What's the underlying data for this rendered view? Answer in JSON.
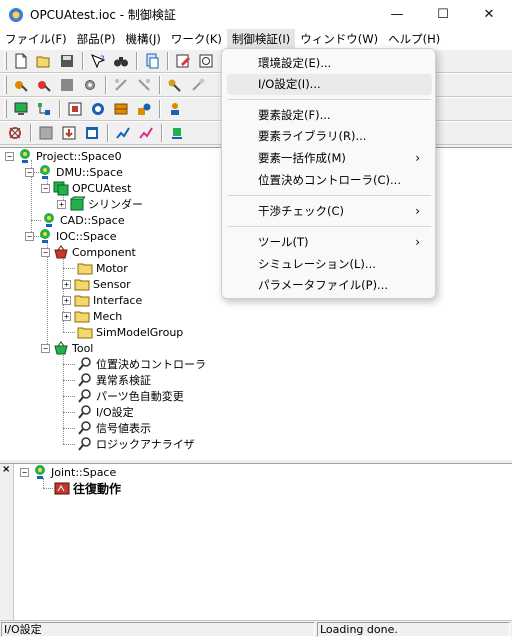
{
  "window": {
    "title": "OPCUAtest.ioc - 制御検証",
    "minimize_glyph": "—",
    "maximize_glyph": "☐",
    "close_glyph": "✕"
  },
  "menubar": {
    "items": [
      {
        "label": "ファイル(F)"
      },
      {
        "label": "部品(P)"
      },
      {
        "label": "機構(J)"
      },
      {
        "label": "ワーク(K)"
      },
      {
        "label": "制御検証(I)"
      },
      {
        "label": "ウィンドウ(W)"
      },
      {
        "label": "ヘルプ(H)"
      }
    ]
  },
  "dropdown": {
    "items": [
      {
        "label": "環境設定(E)..."
      },
      {
        "label": "I/O設定(I)..."
      },
      {
        "label": "要素設定(F)..."
      },
      {
        "label": "要素ライブラリ(R)..."
      },
      {
        "label": "要素一括作成(M)",
        "submenu_glyph": "›"
      },
      {
        "label": "位置決めコントローラ(C)..."
      },
      {
        "label": "干渉チェック(C)",
        "submenu_glyph": "›"
      },
      {
        "label": "ツール(T)",
        "submenu_glyph": "›"
      },
      {
        "label": "シミュレーション(L)..."
      },
      {
        "label": "パラメータファイル(P)..."
      }
    ]
  },
  "tree": {
    "nodes": [
      {
        "label": "Project::Space0",
        "expander": "−"
      },
      {
        "label": "DMU::Space",
        "expander": "−"
      },
      {
        "label": "OPCUAtest",
        "expander": "−"
      },
      {
        "label": "シリンダー",
        "expander": "+"
      },
      {
        "label": "CAD::Space"
      },
      {
        "label": "IOC::Space",
        "expander": "−"
      },
      {
        "label": "Component",
        "expander": "−"
      },
      {
        "label": "Motor"
      },
      {
        "label": "Sensor",
        "expander": "+"
      },
      {
        "label": "Interface",
        "expander": "+"
      },
      {
        "label": "Mech",
        "expander": "+"
      },
      {
        "label": "SimModelGroup"
      },
      {
        "label": "Tool",
        "expander": "−"
      },
      {
        "label": "位置決めコントローラ"
      },
      {
        "label": "異常系検証"
      },
      {
        "label": "パーツ色自動変更"
      },
      {
        "label": "I/O設定"
      },
      {
        "label": "信号値表示"
      },
      {
        "label": "ロジックアナライザ"
      }
    ]
  },
  "lower_tree": {
    "close_glyph": "×",
    "nodes": [
      {
        "label": "Joint::Space",
        "expander": "−"
      },
      {
        "label": "往復動作"
      }
    ]
  },
  "statusbar": {
    "left_text": "I/O設定",
    "right_text": "Loading done."
  },
  "colors": {
    "accent": "#0078d7",
    "folder": "#f5d76e",
    "green_box": "#22b14c",
    "red_box": "#c0392b"
  }
}
